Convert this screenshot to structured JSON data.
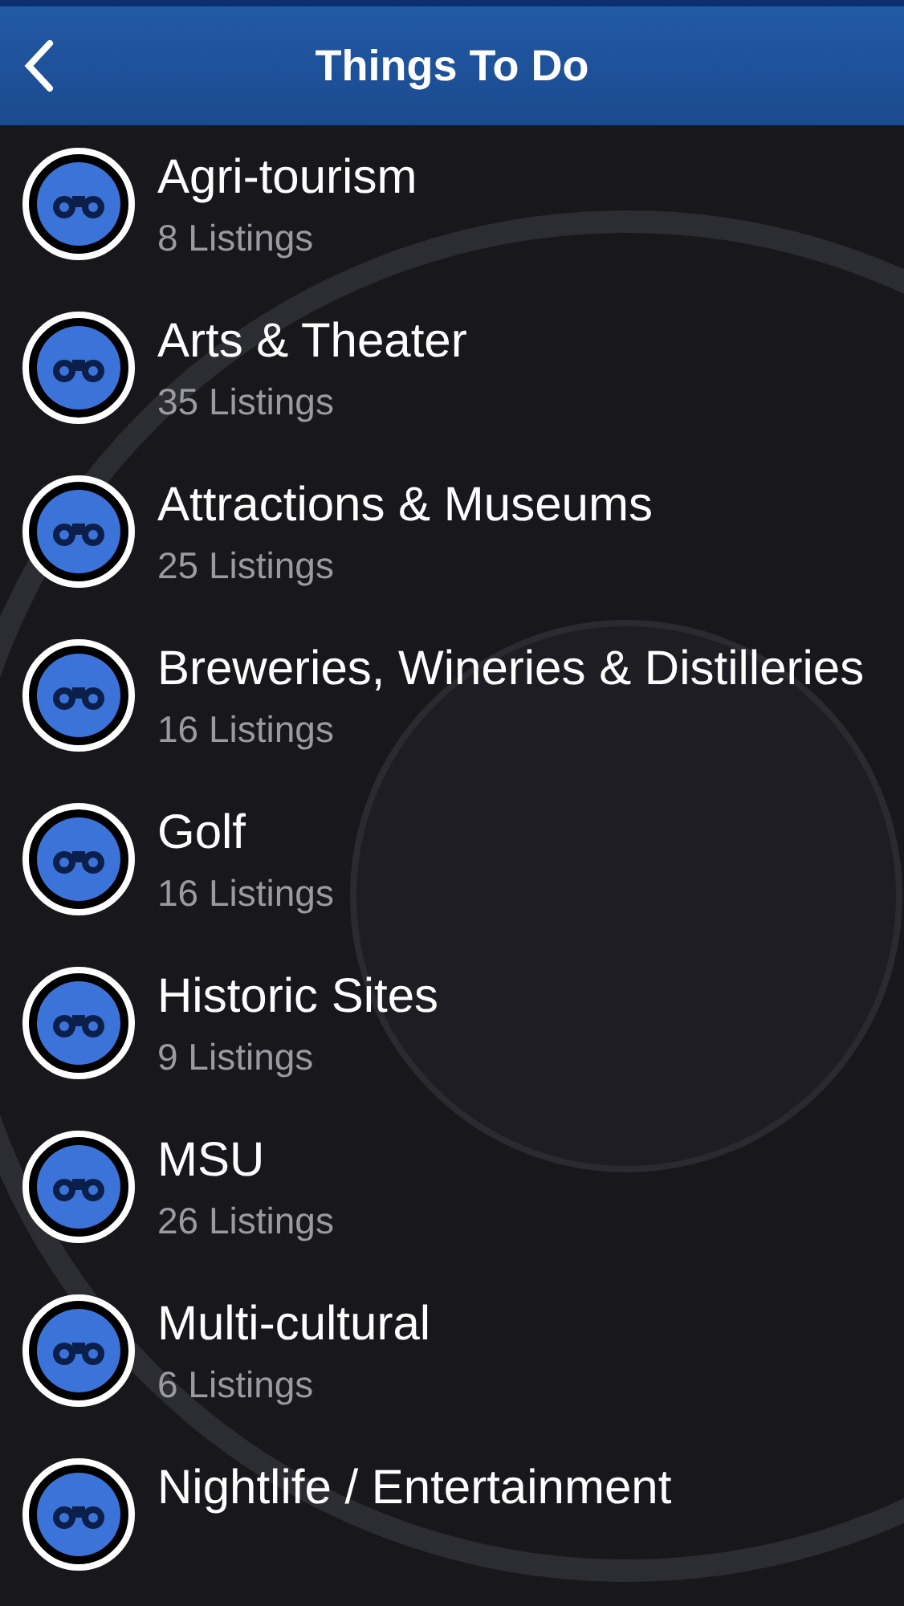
{
  "header": {
    "title": "Things To Do"
  },
  "categories": [
    {
      "name": "Agri-tourism",
      "listings": "8 Listings"
    },
    {
      "name": "Arts & Theater",
      "listings": "35 Listings"
    },
    {
      "name": "Attractions & Museums",
      "listings": "25 Listings"
    },
    {
      "name": "Breweries, Wineries & Distilleries",
      "listings": "16 Listings"
    },
    {
      "name": "Golf",
      "listings": "16 Listings"
    },
    {
      "name": "Historic Sites",
      "listings": "9 Listings"
    },
    {
      "name": "MSU",
      "listings": "26 Listings"
    },
    {
      "name": "Multi-cultural",
      "listings": "6 Listings"
    },
    {
      "name": "Nightlife / Entertainment"
    }
  ]
}
